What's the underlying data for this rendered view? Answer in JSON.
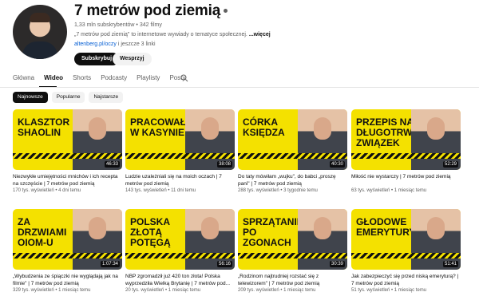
{
  "channel": {
    "title": "7 metrów pod ziemią",
    "meta": "1,33 mln subskrybentów • 342 filmy",
    "description": "„7 metrów pod ziemią\" to internetowe wywiady o tematyce społecznej.",
    "more_label": "...więcej",
    "link": "altenberg.pl/oczy",
    "links_more": " i jeszcze 3 linki"
  },
  "buttons": {
    "subscribe": "Subskrybuj",
    "join": "Wesprzyj"
  },
  "tabs": [
    {
      "label": "Główna"
    },
    {
      "label": "Wideo"
    },
    {
      "label": "Shorts"
    },
    {
      "label": "Podcasty"
    },
    {
      "label": "Playlisty"
    },
    {
      "label": "Posty"
    }
  ],
  "chips": [
    {
      "label": "Najnowsze"
    },
    {
      "label": "Popularne"
    },
    {
      "label": "Najstarsze"
    }
  ],
  "videos": [
    {
      "thumb_text": "KLASZTOR SHAOLIN",
      "duration": "46:33",
      "title": "Niezwykłe umiejętności mnichów i ich recepta na szczęście | 7 metrów pod ziemią",
      "views": "170 tys. wyświetleń • 4 dni temu"
    },
    {
      "thumb_text": "PRACOWAŁEM W KASYNIE",
      "duration": "38:08",
      "title": "Ludzie uzależniali się na moich oczach | 7 metrów pod ziemią",
      "views": "143 tys. wyświetleń • 11 dni temu"
    },
    {
      "thumb_text": "CÓRKA KSIĘDZA",
      "duration": "40:30",
      "title": "Do taty mówiłam „wujku\", do babci „proszę pani\" | 7 metrów pod ziemią",
      "views": "288 tys. wyświetleń • 3 tygodnie temu"
    },
    {
      "thumb_text": "PRZEPIS NA DŁUGOTRWAŁY ZWIĄZEK",
      "duration": "52:29",
      "title": "Miłość nie wystarczy | 7 metrów pod ziemią",
      "views": "63 tys. wyświetleń • 1 miesiąc temu"
    },
    {
      "thumb_text": "ZA DRZWIAMI OIOM-U",
      "duration": "1:07:34",
      "title": "„Wybudzenia ze śpiączki nie wyglądają jak na filmie\" | 7 metrów pod ziemią",
      "views": "329 tys. wyświetleń • 1 miesiąc temu"
    },
    {
      "thumb_text": "POLSKA ZŁOTĄ POTĘGĄ",
      "duration": "56:16",
      "title": "NBP zgromadził już 420 ton złota! Polska wyprzedziła Wielką Brytanię | 7 metrów pod...",
      "views": "20 tys. wyświetleń • 1 miesiąc temu"
    },
    {
      "thumb_text": "SPRZĄTANIE PO ZGONACH",
      "duration": "30:39",
      "title": "„Rodzinom najtrudniej rozstać się z telewizorem\" | 7 metrów pod ziemią",
      "views": "209 tys. wyświetleń • 1 miesiąc temu"
    },
    {
      "thumb_text": "GŁODOWE EMERYTURY",
      "duration": "51:41",
      "title": "Jak zabezpieczyć się przed niską emeryturą? | 7 metrów pod ziemią",
      "views": "51 tys. wyświetleń • 1 miesiąc temu"
    }
  ]
}
